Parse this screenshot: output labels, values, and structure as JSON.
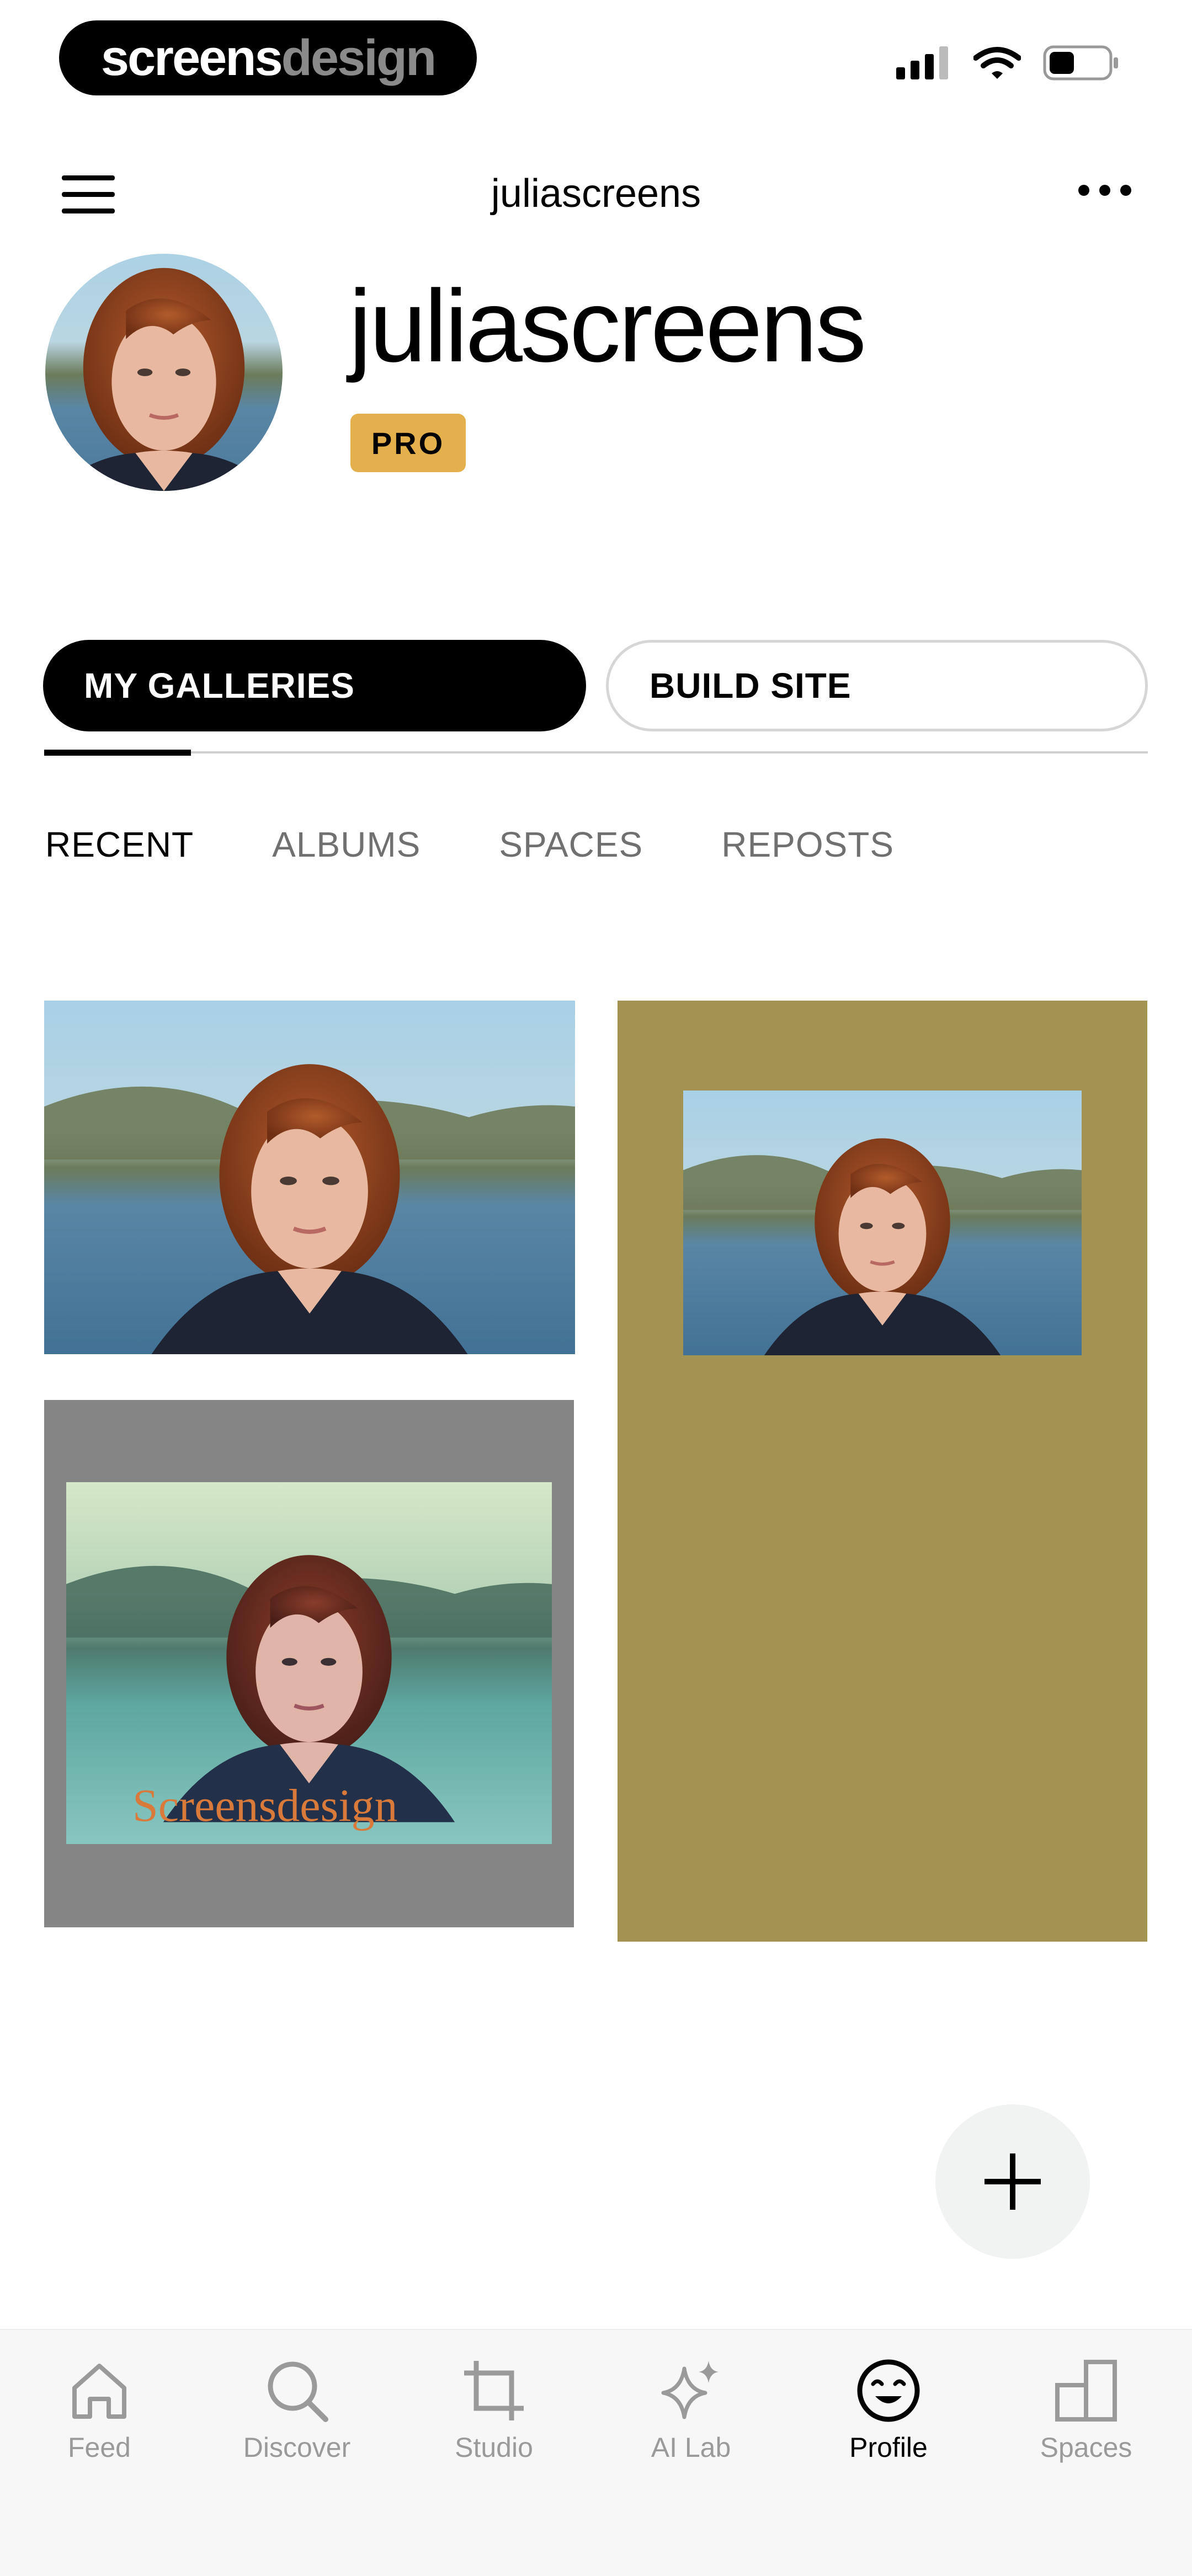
{
  "brand": {
    "part1": "screens",
    "part2": "design"
  },
  "header": {
    "title": "juliascreens"
  },
  "profile": {
    "name": "juliascreens",
    "badge": "PRO"
  },
  "segments": {
    "galleries": "MY GALLERIES",
    "build_site": "BUILD SITE"
  },
  "sub_tabs": [
    "RECENT",
    "ALBUMS",
    "SPACES",
    "REPOSTS"
  ],
  "gallery": {
    "watermark": "Screensdesign"
  },
  "tab_bar": {
    "items": [
      {
        "label": "Feed",
        "icon": "home-icon"
      },
      {
        "label": "Discover",
        "icon": "search-icon"
      },
      {
        "label": "Studio",
        "icon": "crop-icon"
      },
      {
        "label": "AI Lab",
        "icon": "sparkle-icon"
      },
      {
        "label": "Profile",
        "icon": "smile-icon"
      },
      {
        "label": "Spaces",
        "icon": "spaces-icon"
      }
    ]
  },
  "colors": {
    "badge": "#e4b04c",
    "card_olive": "#a39353",
    "card_gray": "#858585",
    "watermark": "#d97a3a"
  }
}
